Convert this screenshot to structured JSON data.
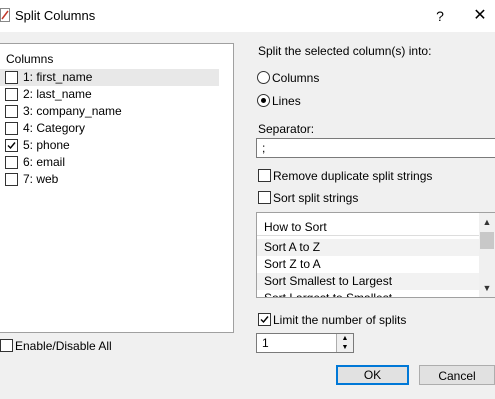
{
  "window": {
    "title": "Split Columns",
    "help_label": "?",
    "close_label": "✕"
  },
  "columns_panel": {
    "header": "Columns",
    "items": [
      {
        "label": "1: first_name",
        "checked": false,
        "selected": true
      },
      {
        "label": "2: last_name",
        "checked": false,
        "selected": false
      },
      {
        "label": "3: company_name",
        "checked": false,
        "selected": false
      },
      {
        "label": "4: Category",
        "checked": false,
        "selected": false
      },
      {
        "label": "5: phone",
        "checked": true,
        "selected": false
      },
      {
        "label": "6: email",
        "checked": false,
        "selected": false
      },
      {
        "label": "7: web",
        "checked": false,
        "selected": false
      }
    ],
    "enable_all_label": "Enable/Disable All"
  },
  "split": {
    "heading": "Split the selected column(s) into:",
    "option_columns": "Columns",
    "option_lines": "Lines",
    "selected": "Lines"
  },
  "separator": {
    "label": "Separator:",
    "value": ";"
  },
  "options": {
    "remove_duplicates": "Remove duplicate split strings",
    "sort_split": "Sort split strings"
  },
  "sort_list": {
    "header": "How to Sort",
    "items": [
      "Sort A to Z",
      "Sort Z to A",
      "Sort Smallest to Largest",
      "Sort Largest to Smallest"
    ]
  },
  "limit": {
    "label": "Limit the number of splits",
    "checked": true,
    "value": "1"
  },
  "buttons": {
    "ok": "OK",
    "cancel": "Cancel"
  }
}
